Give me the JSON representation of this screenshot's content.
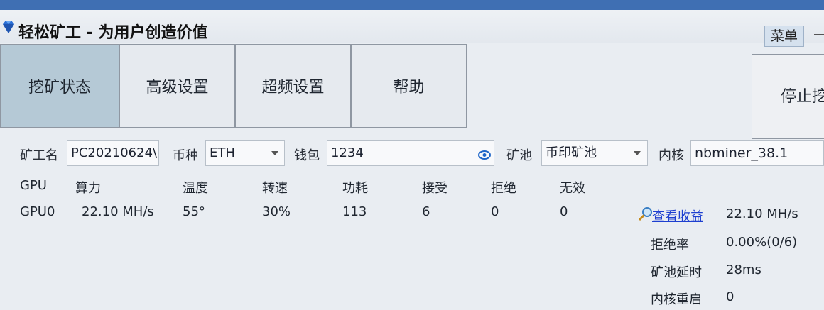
{
  "window": {
    "title": "轻松矿工 - 为用户创造价值",
    "menu_label": "菜单"
  },
  "tabs": [
    {
      "label": "挖矿状态",
      "active": true
    },
    {
      "label": "高级设置",
      "active": false
    },
    {
      "label": "超频设置",
      "active": false
    },
    {
      "label": "帮助",
      "active": false
    }
  ],
  "stop_button": "停止挖",
  "settings": {
    "miner_name_label": "矿工名",
    "miner_name_value": "PC20210624\\",
    "coin_label": "币种",
    "coin_value": "ETH",
    "wallet_label": "钱包",
    "wallet_value": "1234",
    "pool_label": "矿池",
    "pool_value": "币印矿池",
    "kernel_label": "内核",
    "kernel_value": "nbminer_38.1"
  },
  "gpu_table": {
    "headers": [
      "GPU",
      "算力",
      "温度",
      "转速",
      "功耗",
      "接受",
      "拒绝",
      "无效"
    ],
    "rows": [
      [
        "GPU0",
        "22.10 MH/s",
        "55°",
        "30%",
        "113",
        "6",
        "0",
        "0"
      ]
    ]
  },
  "stats": {
    "view_earnings_link": "查看收益",
    "total_hashrate": "22.10 MH/s",
    "reject_rate_label": "拒绝率",
    "reject_rate_value": "0.00%(0/6)",
    "pool_latency_label": "矿池延时",
    "pool_latency_value": "28ms",
    "kernel_restart_label": "内核重启",
    "kernel_restart_value": "0"
  },
  "colors": {
    "active_tab": "#b5c9d6",
    "link": "#1d3fd0",
    "title_strip": "#3f6fb3"
  },
  "icons": [
    "diamond-app-icon",
    "eye-icon",
    "magnifier-icon",
    "dropdown-arrow-icon"
  ]
}
